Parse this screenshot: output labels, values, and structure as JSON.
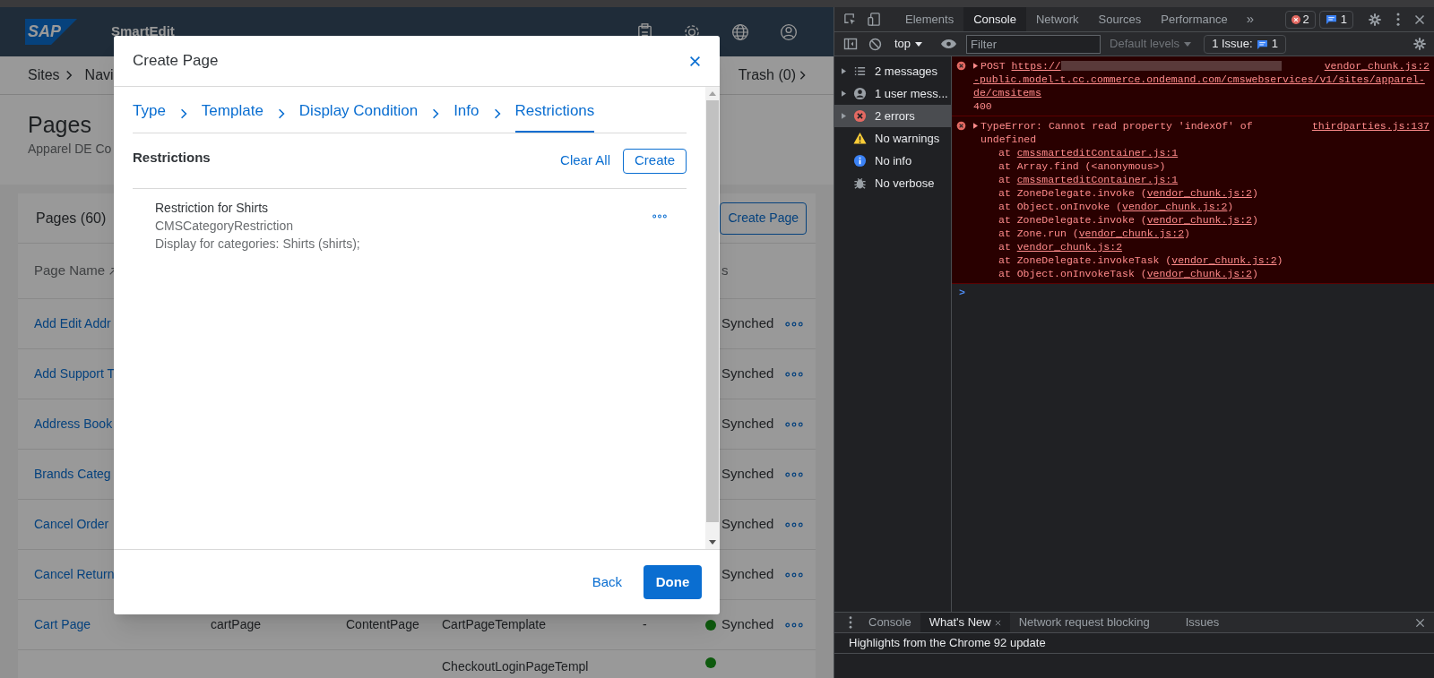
{
  "app": {
    "logo": "SAP",
    "product": "SmartEdit",
    "breadcrumbs": [
      "Sites",
      "Navi"
    ],
    "trash": "Trash (0)",
    "title": "Pages",
    "subtitle": "Apparel DE Co",
    "list_title": "Pages (60)",
    "create_page": "Create Page",
    "table": {
      "columns": [
        "Page Name",
        "s"
      ],
      "rows": [
        {
          "name": "Add Edit Addr",
          "status": "Synched"
        },
        {
          "name": "Add Support T",
          "status": "Synched"
        },
        {
          "name": "Address Book",
          "status": "Synched"
        },
        {
          "name": "Brands Categ",
          "status": "Synched"
        },
        {
          "name": "Cancel Order",
          "status": "Synched"
        },
        {
          "name": "Cancel Return",
          "status": "Synched"
        },
        {
          "name": "Cart Page",
          "uid": "cartPage",
          "type": "ContentPage",
          "template": "CartPageTemplate",
          "sync": "-",
          "status": "Synched",
          "color": "#0e5a0e"
        },
        {
          "template": "CheckoutLoginPageTempl",
          "color": "#0e5a0e"
        }
      ]
    }
  },
  "modal": {
    "title": "Create Page",
    "steps": [
      {
        "label": "Type",
        "selected": false
      },
      {
        "label": "Template",
        "selected": false
      },
      {
        "label": "Display Condition",
        "selected": false
      },
      {
        "label": "Info",
        "selected": false
      },
      {
        "label": "Restrictions",
        "selected": true
      }
    ],
    "section_title": "Restrictions",
    "clear_all": "Clear All",
    "create": "Create",
    "restrictions": [
      {
        "name": "Restriction for Shirts",
        "type": "CMSCategoryRestriction",
        "description": "Display for categories: Shirts (shirts);"
      }
    ],
    "back": "Back",
    "done": "Done"
  },
  "devtools": {
    "tabs": [
      {
        "label": "Elements",
        "selected": false
      },
      {
        "label": "Console",
        "selected": true
      },
      {
        "label": "Network",
        "selected": false
      },
      {
        "label": "Sources",
        "selected": false
      },
      {
        "label": "Performance",
        "selected": false
      }
    ],
    "overflow": "»",
    "error_count": "2",
    "message_count": "1",
    "context": "top",
    "filter_placeholder": "Filter",
    "levels": "Default levels",
    "issues_label": "1 Issue:",
    "issues_count": "1",
    "sidebar": [
      {
        "kind": "messages",
        "label": "2 messages",
        "selected": false
      },
      {
        "kind": "user",
        "label": "1 user mess...",
        "selected": false
      },
      {
        "kind": "error",
        "label": "2 errors",
        "selected": true
      },
      {
        "kind": "warning",
        "label": "No warnings",
        "selected": false
      },
      {
        "kind": "info",
        "label": "No info",
        "selected": false
      },
      {
        "kind": "verbose",
        "label": "No verbose",
        "selected": false
      }
    ],
    "messages": [
      {
        "kind": "request",
        "method": "POST",
        "url_start": "https://",
        "url_end": "-public.model-t.cc.commerce.ondemand.com/cmswebservices/v1/sites/apparel-de/cmsitems",
        "code": "400",
        "source": "vendor_chunk.js:2"
      },
      {
        "kind": "exception",
        "text": "TypeError: Cannot read property 'indexOf' of undefined",
        "source": "thirdparties.js:137",
        "stack": [
          {
            "text": "at ",
            "link": "cmssmarteditContainer.js:1"
          },
          {
            "text": "at Array.find (<anonymous>)"
          },
          {
            "text": "at ",
            "link": "cmssmarteditContainer.js:1"
          },
          {
            "text": "at ZoneDelegate.invoke (",
            "link": "vendor_chunk.js:2",
            "tail": ")"
          },
          {
            "text": "at Object.onInvoke (",
            "link": "vendor_chunk.js:2",
            "tail": ")"
          },
          {
            "text": "at ZoneDelegate.invoke (",
            "link": "vendor_chunk.js:2",
            "tail": ")"
          },
          {
            "text": "at Zone.run (",
            "link": "vendor_chunk.js:2",
            "tail": ")"
          },
          {
            "text": "at ",
            "link": "vendor_chunk.js:2"
          },
          {
            "text": "at ZoneDelegate.invokeTask (",
            "link": "vendor_chunk.js:2",
            "tail": ")"
          },
          {
            "text": "at Object.onInvokeTask (",
            "link": "vendor_chunk.js:2",
            "tail": ")"
          }
        ]
      }
    ],
    "prompt": ">",
    "drawer_tabs": [
      {
        "label": "Console",
        "selected": false,
        "closable": false
      },
      {
        "label": "What's New",
        "selected": true,
        "closable": true
      },
      {
        "label": "Network request blocking",
        "selected": false,
        "closable": false
      },
      {
        "label": "Issues",
        "selected": false,
        "closable": false
      }
    ],
    "drawer_heading": "Highlights from the Chrome 92 update"
  }
}
